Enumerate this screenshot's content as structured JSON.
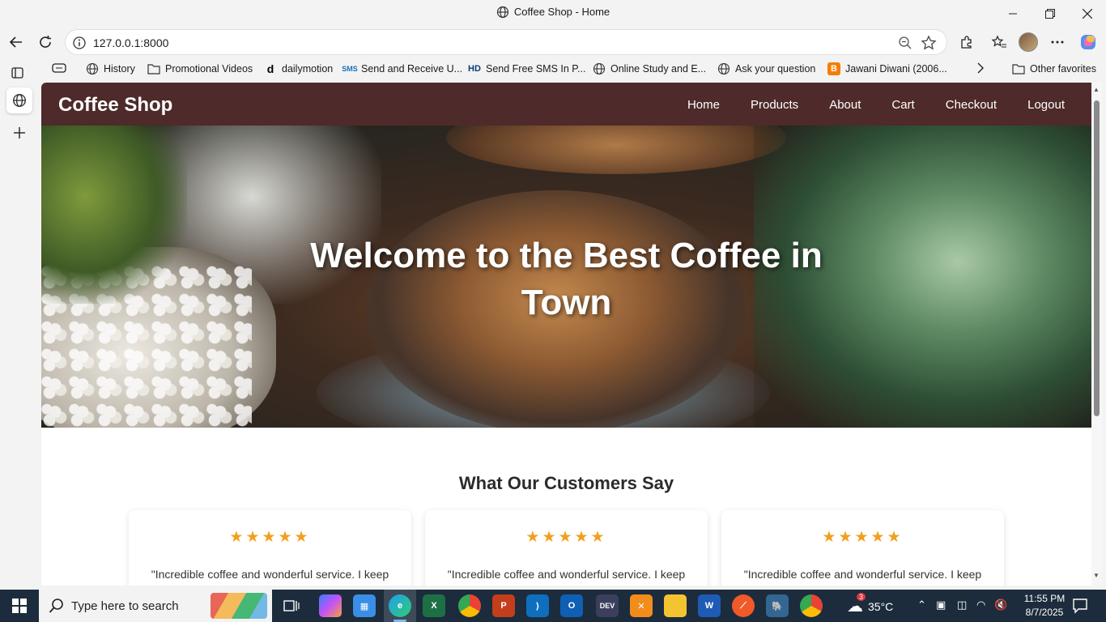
{
  "browser": {
    "tab_title": "Coffee Shop - Home",
    "url": "127.0.0.1:8000",
    "favorites": [
      {
        "label": "History",
        "icon": "globe-icon"
      },
      {
        "label": "Promotional Videos",
        "icon": "folder-icon"
      },
      {
        "label": "dailymotion",
        "icon": "dailymotion-icon"
      },
      {
        "label": "Send and Receive U...",
        "icon": "sms-icon"
      },
      {
        "label": "Send Free SMS In P...",
        "icon": "hd-icon"
      },
      {
        "label": "Online Study and E...",
        "icon": "globe-icon"
      },
      {
        "label": "Ask your question",
        "icon": "globe-icon"
      },
      {
        "label": "Jawani Diwani (2006...",
        "icon": "blogger-icon"
      }
    ],
    "other_favorites": "Other favorites"
  },
  "site": {
    "brand": "Coffee Shop",
    "menu": [
      "Home",
      "Products",
      "About",
      "Cart",
      "Checkout",
      "Logout"
    ],
    "hero_line1": "Welcome to the Best Coffee in",
    "hero_line2": "Town",
    "testimonials_title": "What Our Customers Say",
    "testimonials": [
      {
        "stars": "★★★★★",
        "quote": "\"Incredible coffee and wonderful service. I keep coming back!\""
      },
      {
        "stars": "★★★★★",
        "quote": "\"Incredible coffee and wonderful service. I keep coming back!\""
      },
      {
        "stars": "★★★★★",
        "quote": "\"Incredible coffee and wonderful service. I keep coming back!\""
      }
    ]
  },
  "taskbar": {
    "search_placeholder": "Type here to search",
    "weather_temp": "35°C",
    "weather_badge": "3",
    "time": "11:55 PM",
    "date": "8/7/2025"
  },
  "colors": {
    "nav_bg": "#4e2a2a",
    "star": "#f0a01e",
    "taskbar": "#1c2c3c"
  }
}
